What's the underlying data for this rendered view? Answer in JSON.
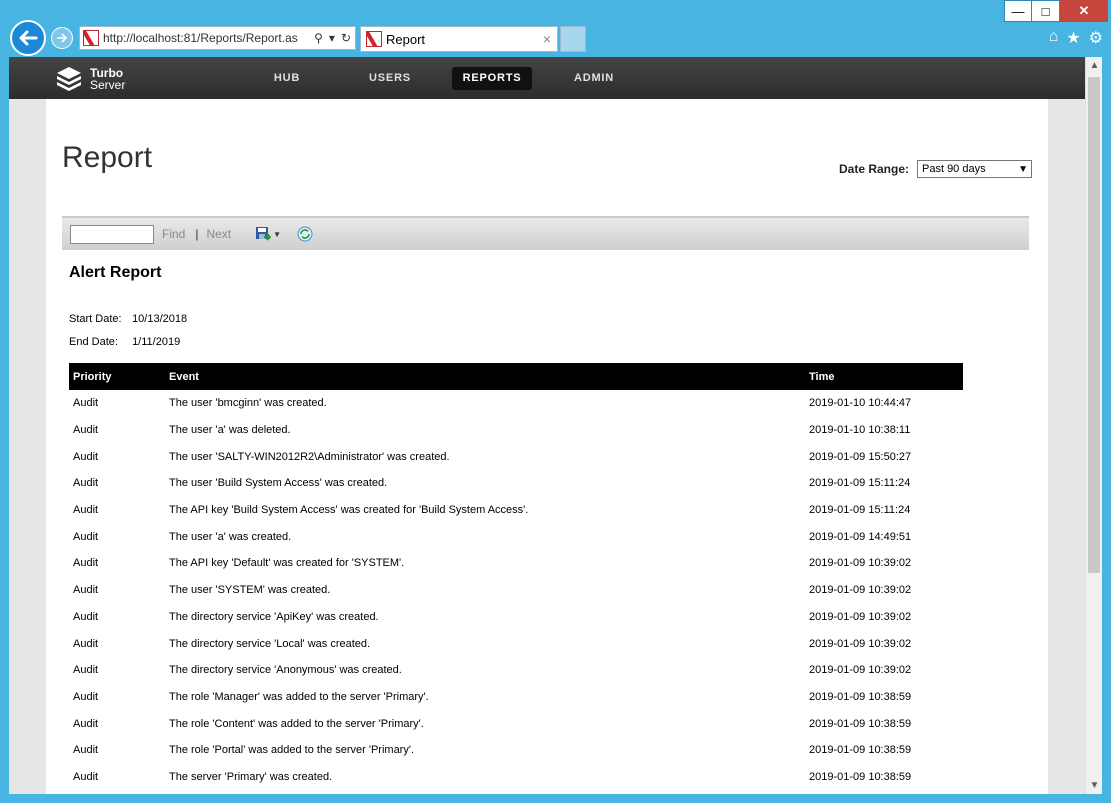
{
  "browser": {
    "url": "http://localhost:81/Reports/Report.as",
    "tab_title": "Report",
    "tab_close": "×",
    "window_controls": {
      "minimize": "—",
      "maximize": "□",
      "close": "✕"
    }
  },
  "site": {
    "logo_line1": "Turbo",
    "logo_line2": "Server",
    "nav": [
      {
        "label": "HUB",
        "active": false
      },
      {
        "label": "USERS",
        "active": false
      },
      {
        "label": "REPORTS",
        "active": true
      },
      {
        "label": "ADMIN",
        "active": false
      }
    ]
  },
  "page": {
    "title": "Report",
    "date_range_label": "Date Range:",
    "date_range_value": "Past 90 days"
  },
  "toolbar": {
    "find": "Find",
    "separator": "|",
    "next": "Next"
  },
  "report": {
    "title": "Alert Report",
    "start_label": "Start Date:",
    "start_value": "10/13/2018",
    "end_label": "End Date:",
    "end_value": "1/11/2019",
    "columns": [
      "Priority",
      "Event",
      "Time"
    ],
    "rows": [
      [
        "Audit",
        "The user 'bmcginn' was created.",
        "2019-01-10 10:44:47"
      ],
      [
        "Audit",
        "The user 'a' was deleted.",
        "2019-01-10 10:38:11"
      ],
      [
        "Audit",
        "The user 'SALTY-WIN2012R2\\Administrator' was created.",
        "2019-01-09 15:50:27"
      ],
      [
        "Audit",
        "The user 'Build System Access' was created.",
        "2019-01-09 15:11:24"
      ],
      [
        "Audit",
        "The API key 'Build System Access' was created for 'Build System Access'.",
        "2019-01-09 15:11:24"
      ],
      [
        "Audit",
        "The user 'a' was created.",
        "2019-01-09 14:49:51"
      ],
      [
        "Audit",
        "The API key 'Default' was created for 'SYSTEM'.",
        "2019-01-09 10:39:02"
      ],
      [
        "Audit",
        "The user 'SYSTEM' was created.",
        "2019-01-09 10:39:02"
      ],
      [
        "Audit",
        "The directory service 'ApiKey' was created.",
        "2019-01-09 10:39:02"
      ],
      [
        "Audit",
        "The directory service 'Local' was created.",
        "2019-01-09 10:39:02"
      ],
      [
        "Audit",
        "The directory service 'Anonymous' was created.",
        "2019-01-09 10:39:02"
      ],
      [
        "Audit",
        "The role 'Manager' was added to the server 'Primary'.",
        "2019-01-09 10:38:59"
      ],
      [
        "Audit",
        "The role 'Content' was added to the server 'Primary'.",
        "2019-01-09 10:38:59"
      ],
      [
        "Audit",
        "The role 'Portal' was added to the server 'Primary'.",
        "2019-01-09 10:38:59"
      ],
      [
        "Audit",
        "The server 'Primary' was created.",
        "2019-01-09 10:38:59"
      ]
    ]
  }
}
